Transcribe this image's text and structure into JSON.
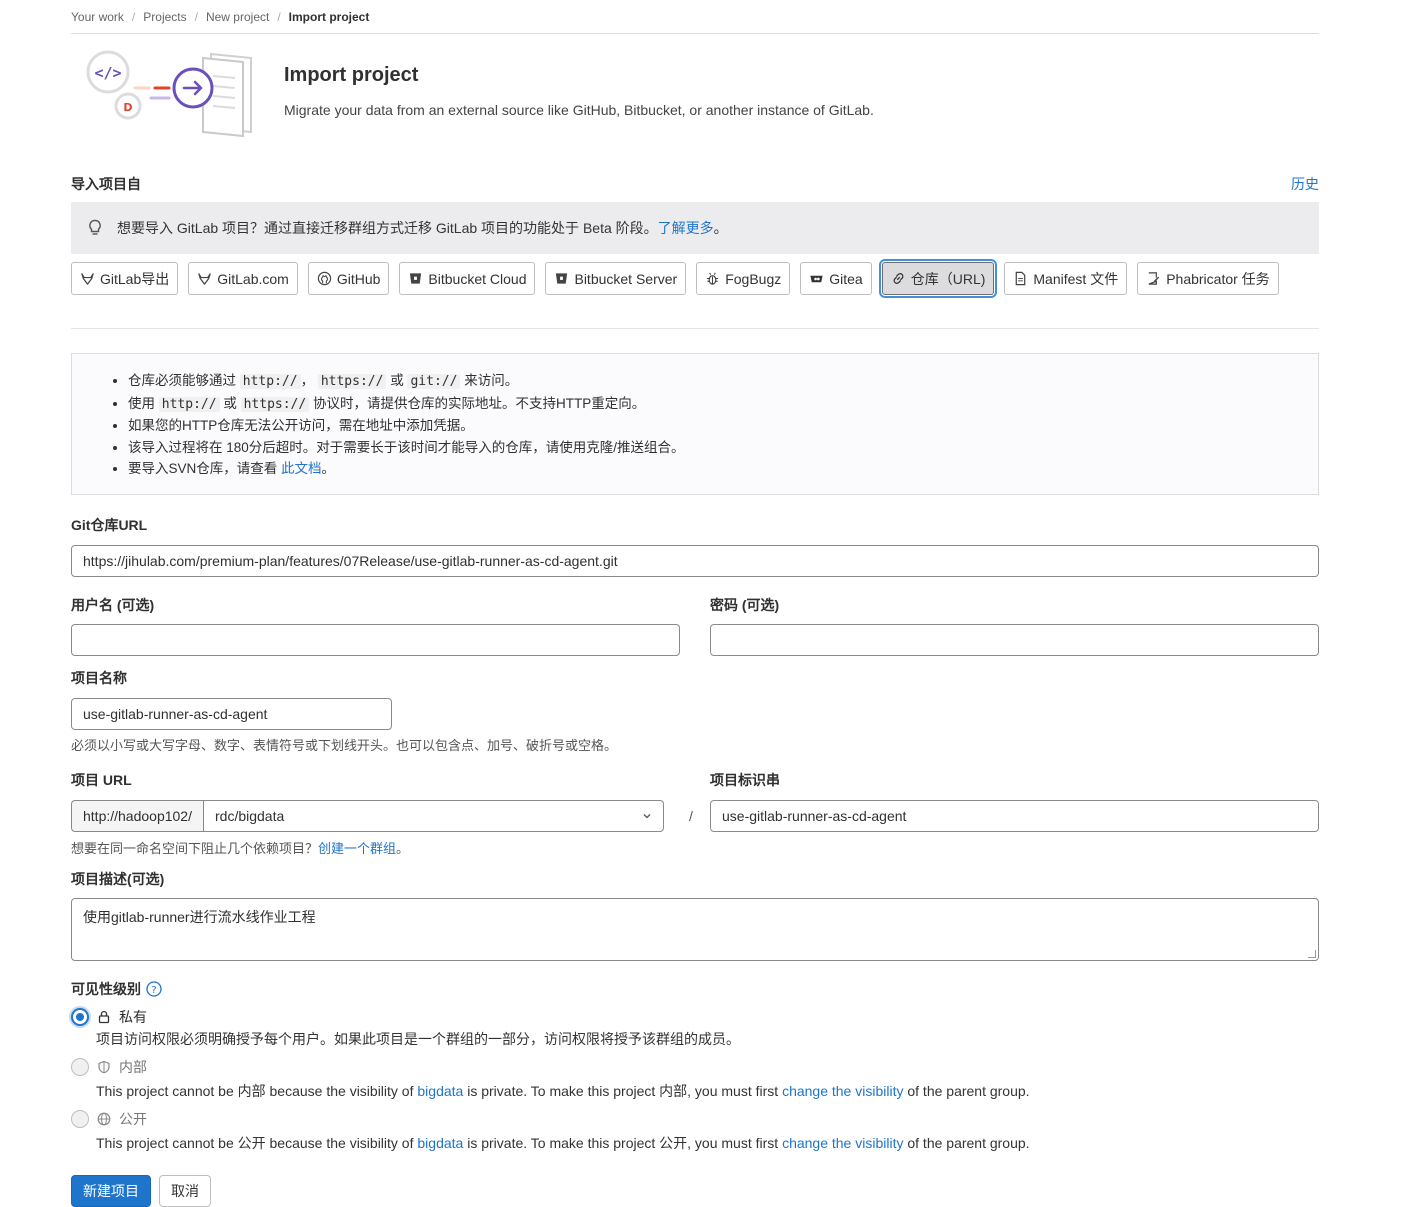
{
  "breadcrumb": [
    "Your work",
    "Projects",
    "New project",
    "Import project"
  ],
  "hero": {
    "title": "Import project",
    "subtitle": "Migrate your data from an external source like GitHub, Bitbucket, or another instance of GitLab."
  },
  "import_from": {
    "label": "导入项目自",
    "history": "历史"
  },
  "alert": {
    "text": "想要导入 GitLab 项目？通过直接迁移群组方式迁移 GitLab 项目的功能处于 Beta 阶段。",
    "link": "了解更多",
    "suffix": "。"
  },
  "sources": [
    {
      "label": "GitLab导出",
      "icon": "tanuki-icon"
    },
    {
      "label": "GitLab.com",
      "icon": "tanuki-icon"
    },
    {
      "label": "GitHub",
      "icon": "github-icon"
    },
    {
      "label": "Bitbucket Cloud",
      "icon": "bitbucket-icon"
    },
    {
      "label": "Bitbucket Server",
      "icon": "bitbucket-icon"
    },
    {
      "label": "FogBugz",
      "icon": "bug-icon"
    },
    {
      "label": "Gitea",
      "icon": "gitea-icon"
    },
    {
      "label": "仓库（URL)",
      "icon": "link-icon",
      "active": true
    },
    {
      "label": "Manifest 文件",
      "icon": "document-icon"
    },
    {
      "label": "Phabricator 任务",
      "icon": "issue-icon"
    }
  ],
  "info": {
    "l1": {
      "a": "仓库必须能够通过",
      "c1": "http://",
      "b": "，",
      "c2": "https://",
      "c": "或",
      "c3": "git://",
      "d": "来访问。"
    },
    "l2": {
      "a": "使用",
      "c1": "http://",
      "b": "或",
      "c2": "https://",
      "c": "协议时，请提供仓库的实际地址。不支持HTTP重定向。"
    },
    "l3": "如果您的HTTP仓库无法公开访问，需在地址中添加凭据。",
    "l4": "该导入过程将在 180分后超时。对于需要长于该时间才能导入的仓库，请使用克隆/推送组合。",
    "l5": {
      "a": "要导入SVN仓库，请查看",
      "link": "此文档",
      "b": "。"
    }
  },
  "form": {
    "git_url_label": "Git仓库URL",
    "git_url_value": "https://jihulab.com/premium-plan/features/07Release/use-gitlab-runner-as-cd-agent.git",
    "username_label": "用户名 (可选)",
    "password_label": "密码 (可选)",
    "project_name_label": "项目名称",
    "project_name_value": "use-gitlab-runner-as-cd-agent",
    "project_name_help": "必须以小写或大写字母、数字、表情符号或下划线开头。也可以包含点、加号、破折号或空格。",
    "project_url_label": "项目 URL",
    "url_prefix": "http://hadoop102/",
    "namespace": "rdc/bigdata",
    "slash": "/",
    "slug_label": "项目标识串",
    "slug_value": "use-gitlab-runner-as-cd-agent",
    "group_help": "想要在同一命名空间下阻止几个依赖项目？",
    "group_link": "创建一个群组",
    "group_suffix": "。",
    "desc_label": "项目描述(可选)",
    "desc_value": "使用gitlab-runner进行流水线作业工程",
    "visibility_label": "可见性级别"
  },
  "visibility": {
    "private": {
      "label": "私有",
      "desc": "项目访问权限必须明确授予每个用户。如果此项目是一个群组的一部分，访问权限将授予该群组的成员。"
    },
    "internal": {
      "label": "内部",
      "d1": "This project cannot be 内部 because the visibility of",
      "group": "bigdata",
      "d2": "is private. To make this project 内部, you must first",
      "link": "change the visibility",
      "d3": "of the parent group."
    },
    "public": {
      "label": "公开",
      "d1": "This project cannot be 公开 because the visibility of",
      "group": "bigdata",
      "d2": "is private. To make this project 公开, you must first",
      "link": "change the visibility",
      "d3": "of the parent group."
    }
  },
  "actions": {
    "create": "新建项目",
    "cancel": "取消"
  },
  "colors": {
    "primary": "#1f75cb",
    "alert_bg": "#ececef",
    "border": "#89888d"
  }
}
